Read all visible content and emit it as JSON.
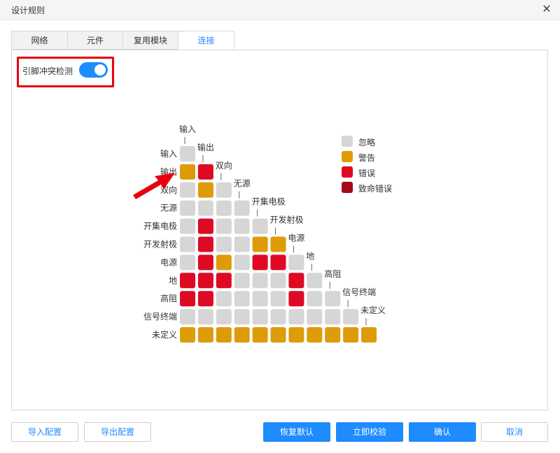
{
  "window": {
    "title": "设计规则"
  },
  "tabs": [
    {
      "label": "网络",
      "active": false
    },
    {
      "label": "元件",
      "active": false
    },
    {
      "label": "复用模块",
      "active": false
    },
    {
      "label": "连接",
      "active": true
    }
  ],
  "toggle": {
    "label": "引脚冲突检测",
    "on": true
  },
  "colors": {
    "accent": "#1e8bff",
    "ignore": "#d6d6d6",
    "warning": "#dd9c07",
    "error": "#de0a24",
    "fatal": "#a10a16",
    "highlight": "#e60012"
  },
  "legend": [
    {
      "label": "忽略",
      "level": "ignore"
    },
    {
      "label": "警告",
      "level": "warning"
    },
    {
      "label": "错误",
      "level": "error"
    },
    {
      "label": "致命错误",
      "level": "fatal"
    }
  ],
  "matrix": {
    "pin_types": [
      "输入",
      "输出",
      "双向",
      "无源",
      "开集电极",
      "开发射极",
      "电源",
      "地",
      "高阻",
      "信号终端",
      "未定义"
    ],
    "cells": [
      [
        "ignore"
      ],
      [
        "warning",
        "error"
      ],
      [
        "ignore",
        "warning",
        "ignore"
      ],
      [
        "ignore",
        "ignore",
        "ignore",
        "ignore"
      ],
      [
        "ignore",
        "error",
        "ignore",
        "ignore",
        "ignore"
      ],
      [
        "ignore",
        "error",
        "ignore",
        "ignore",
        "warning",
        "warning"
      ],
      [
        "ignore",
        "error",
        "warning",
        "ignore",
        "error",
        "error",
        "ignore"
      ],
      [
        "error",
        "error",
        "error",
        "ignore",
        "ignore",
        "ignore",
        "error",
        "ignore"
      ],
      [
        "error",
        "error",
        "ignore",
        "ignore",
        "ignore",
        "ignore",
        "error",
        "ignore",
        "ignore"
      ],
      [
        "ignore",
        "ignore",
        "ignore",
        "ignore",
        "ignore",
        "ignore",
        "ignore",
        "ignore",
        "ignore",
        "ignore"
      ],
      [
        "warning",
        "warning",
        "warning",
        "warning",
        "warning",
        "warning",
        "warning",
        "warning",
        "warning",
        "warning",
        "warning"
      ]
    ]
  },
  "buttons": {
    "import": "导入配置",
    "export": "导出配置",
    "reset": "恢复默认",
    "verify": "立即校验",
    "ok": "确认",
    "cancel": "取消"
  }
}
